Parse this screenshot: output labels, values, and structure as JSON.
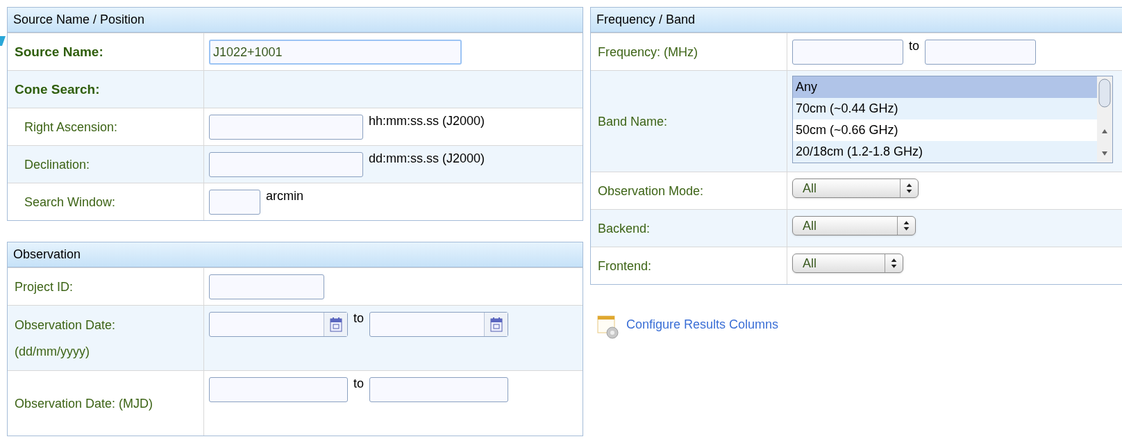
{
  "sections": [
    {
      "title": "Source Name / Position",
      "rows": [
        {
          "label": "Source Name:",
          "kind": "heading",
          "controls": [
            {
              "kind": "text",
              "value": "J1022+1001",
              "focused": true
            }
          ]
        },
        {
          "label": "Cone Search:",
          "kind": "heading",
          "controls": []
        },
        {
          "label": "Right Ascension:",
          "kind": "sub",
          "controls": [
            {
              "kind": "text",
              "focused": false
            },
            {
              "kind": "note",
              "text": "hh:mm:ss.ss (J2000)"
            }
          ]
        },
        {
          "label": "Declination:",
          "kind": "sub",
          "controls": [
            {
              "kind": "text",
              "focused": false
            },
            {
              "kind": "note",
              "text": "dd:mm:ss.ss (J2000)"
            }
          ]
        },
        {
          "label": "Search Window:",
          "kind": "sub",
          "controls": [
            {
              "kind": "text",
              "focused": false
            },
            {
              "kind": "note",
              "text": "arcmin"
            }
          ]
        }
      ]
    },
    {
      "title": "Observation",
      "rows": [
        {
          "label": "Project ID:",
          "kind": "plain",
          "controls": [
            {
              "kind": "text",
              "focused": false
            }
          ]
        },
        {
          "label": "Observation Date: (dd/mm/yyyy)",
          "kind": "plain",
          "controls": [
            {
              "kind": "date"
            },
            {
              "kind": "note",
              "text": "to"
            },
            {
              "kind": "date"
            }
          ]
        },
        {
          "label": "Observation Date: (MJD)",
          "kind": "plain",
          "controls": [
            {
              "kind": "text",
              "focused": false
            },
            {
              "kind": "note",
              "text": "to"
            },
            {
              "kind": "text",
              "focused": false
            }
          ]
        }
      ]
    },
    {
      "title": "Frequency / Band",
      "rows": [
        {
          "label": "Frequency: (MHz)",
          "kind": "plain",
          "controls": [
            {
              "kind": "text",
              "focused": false
            },
            {
              "kind": "note",
              "text": "to"
            },
            {
              "kind": "text",
              "focused": false
            }
          ]
        },
        {
          "label": "Band Name:",
          "kind": "plain",
          "controls": [
            {
              "kind": "listbox",
              "options": [
                {
                  "label": "Any",
                  "selected": true
                },
                {
                  "label": "70cm (~0.44 GHz)",
                  "selected": false
                },
                {
                  "label": "50cm (~0.66 GHz)",
                  "selected": false
                },
                {
                  "label": "20/18cm (1.2-1.8 GHz)",
                  "selected": false
                }
              ]
            }
          ]
        },
        {
          "label": "Observation Mode:",
          "kind": "plain",
          "controls": [
            {
              "kind": "select",
              "value": "All"
            }
          ]
        },
        {
          "label": "Backend:",
          "kind": "plain",
          "controls": [
            {
              "kind": "select",
              "value": "All"
            }
          ]
        },
        {
          "label": "Frontend:",
          "kind": "plain",
          "controls": [
            {
              "kind": "select",
              "value": "All"
            }
          ]
        }
      ]
    }
  ],
  "configure_link": "Configure Results Columns"
}
